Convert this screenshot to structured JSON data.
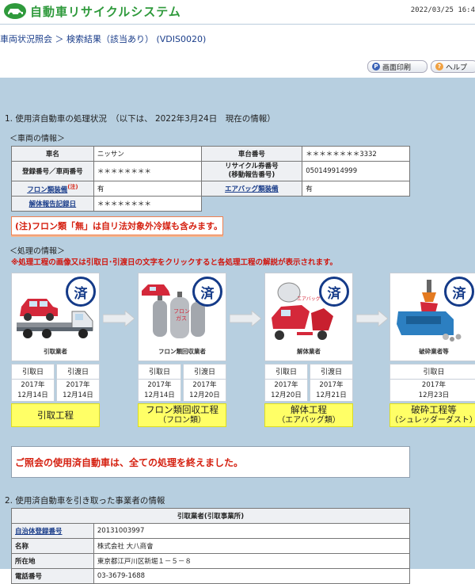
{
  "header": {
    "app_title": "自動車リサイクルシステム",
    "timestamp": "2022/03/25 16:4"
  },
  "breadcrumb": {
    "text": "車両状況照会 ＞ 検索結果（該当あり） (VDIS0020)"
  },
  "toolbar": {
    "print_label": "画面印刷",
    "help_label": "ヘルプ"
  },
  "section1": {
    "title": "1. 使用済自動車の処理状況　（以下は、 2022年3月24日　現在の情報）",
    "vehicle_heading": "＜車両の情報＞",
    "vehicle": {
      "maker_label": "車名",
      "maker_value": "ニッサン",
      "chassis_label": "車台番号",
      "chassis_value": "＊＊＊＊＊＊＊＊3332",
      "reg_label": "登録番号／車両番号",
      "reg_value": "＊＊＊＊＊＊＊＊",
      "ticket_label_1": "リサイクル券番号",
      "ticket_label_2": "(移動報告番号)",
      "ticket_value": "050149914999",
      "freon_label": "フロン類装備",
      "freon_note": "(注)",
      "freon_value": "有",
      "airbag_label": "エアバッグ類装備",
      "airbag_value": "有",
      "dismantle_label": "解体報告記録日",
      "dismantle_value": "＊＊＊＊＊＊＊＊"
    },
    "note": "(注)フロン類「無」は自リ法対象外冷媒も含みます。",
    "process_heading": "＜処理の情報＞",
    "warning": "※処理工程の画像又は引取日･引渡日の文字をクリックすると各処理工程の解説が表示されます。",
    "steps": [
      {
        "caption": "引取業者",
        "stamp": "済",
        "cols": [
          {
            "head": "引取日",
            "year": "2017年",
            "date": "12月14日"
          },
          {
            "head": "引渡日",
            "year": "2017年",
            "date": "12月14日"
          }
        ],
        "label_main": "引取工程",
        "label_sub": ""
      },
      {
        "caption": "フロン類回収業者",
        "stamp": "済",
        "cols": [
          {
            "head": "引取日",
            "year": "2017年",
            "date": "12月14日"
          },
          {
            "head": "引渡日",
            "year": "2017年",
            "date": "12月20日"
          }
        ],
        "label_main": "フロン類回収工程",
        "label_sub": "（フロン類）"
      },
      {
        "caption": "解体業者",
        "stamp": "済",
        "cols": [
          {
            "head": "引取日",
            "year": "2017年",
            "date": "12月20日"
          },
          {
            "head": "引渡日",
            "year": "2017年",
            "date": "12月21日"
          }
        ],
        "label_main": "解体工程",
        "label_sub": "（エアバッグ類）"
      },
      {
        "caption": "破砕業者等",
        "stamp": "済",
        "cols": [
          {
            "head": "引取日",
            "year": "2017年",
            "date": "12月23日"
          }
        ],
        "label_main": "破砕工程等",
        "label_sub": "（シュレッダーダスト）"
      }
    ],
    "complete_message": "ご照会の使用済自動車は、全ての処理を終えました。"
  },
  "section2": {
    "title": "2. 使用済自動車を引き取った事業者の情報",
    "table_header": "引取業者(引取事業所)",
    "rows": [
      {
        "label": "自治体登録番号",
        "value": "20131003997"
      },
      {
        "label": "名称",
        "value": "株式会社 大八商會"
      },
      {
        "label": "所在地",
        "value": "東京都江戸川区新堀１－５－８"
      },
      {
        "label": "電話番号",
        "value": "03-3679-1688"
      }
    ]
  },
  "colors": {
    "brand_green": "#2f9a3c",
    "link_blue": "#1a3d8a",
    "panel_bg": "#b7cfe0",
    "highlight_yellow": "#ffff66",
    "alert_red": "#d52010",
    "stamp_navy": "#143a88"
  }
}
